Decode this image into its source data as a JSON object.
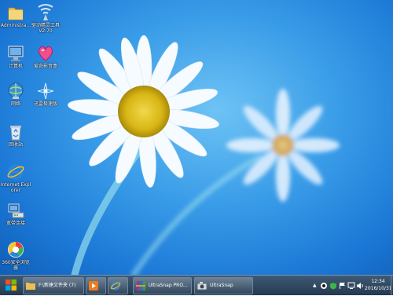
{
  "desktop": {
    "icons": [
      {
        "label": "Administra...",
        "icon": "folder-icon"
      },
      {
        "label": "驱动精灵工具 V2.70",
        "icon": "driver-tool-icon"
      },
      {
        "label": "计算机",
        "icon": "computer-icon"
      },
      {
        "label": "爱奇影音盒",
        "icon": "heart-player-icon"
      },
      {
        "label": "网络",
        "icon": "network-icon"
      },
      {
        "label": "迅雷极速版",
        "icon": "xunlei-icon"
      },
      {
        "label": "回收站",
        "icon": "recycle-bin-icon"
      },
      {
        "label": "Internet Explorer",
        "icon": "internet-explorer-icon"
      },
      {
        "label": "宽带连接",
        "icon": "broadband-icon"
      },
      {
        "label": "360安全浏览器",
        "icon": "browser-360-icon"
      }
    ]
  },
  "taskbar": {
    "folder_window": "F:\\新建文件夹 (7)",
    "ultrasnap_pro": "UltraSnap PRO...",
    "ultrasnap": "UltraSnap",
    "clock_time": "12:34",
    "clock_date": "2016/10/31"
  },
  "colors": {
    "taskbar": "#24394f",
    "desktop_blue": "#3a9de8"
  }
}
